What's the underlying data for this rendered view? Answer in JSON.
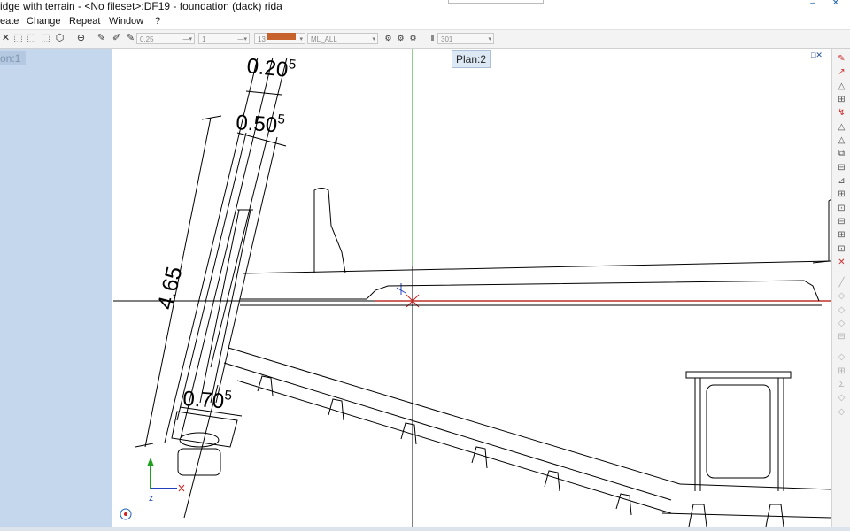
{
  "window": {
    "title": "idge with terrain - <No fileset>:DF19 - foundation (dack) rida",
    "buttons": "–  ✕"
  },
  "menu": [
    "eate",
    "Change",
    "Repeat",
    "Window",
    "?"
  ],
  "toolbar": {
    "icons": [
      "✕",
      "⬚",
      "⬚",
      "⬚",
      "⬡",
      "⊕",
      "✎",
      "✐",
      "✎"
    ],
    "pen_thickness": "0.25",
    "line_type": "1",
    "color_number": "13",
    "layer": "ML_ALL",
    "pattern_number": "301"
  },
  "views": {
    "left_tab": "on:1",
    "main_tab": "Plan:2",
    "window_controls": "□✕"
  },
  "dimensions": [
    {
      "base": "0.20",
      "sup": "5"
    },
    {
      "base": "0.50",
      "sup": "5"
    },
    {
      "base": "4.65",
      "sup": ""
    },
    {
      "base": "0.70",
      "sup": "5"
    }
  ],
  "axis_labels": {
    "z": "z"
  },
  "colors": {
    "accent": "#2060b0",
    "swatch": "#c8622c",
    "crosshair_green": "#1ea01e",
    "crosshair_red": "#d02020"
  },
  "right_tools": [
    "✎",
    "↗",
    "△",
    "⊞",
    "↯",
    "△",
    "△",
    "⧉",
    "⊟",
    "⊿",
    "⊞",
    "⊡",
    "⊟",
    "⊞",
    "⊡",
    "✕",
    "╱",
    "◇",
    "◇",
    "◇",
    "⊟",
    "◇",
    "⊞",
    "Σ",
    "◇",
    "◇"
  ]
}
